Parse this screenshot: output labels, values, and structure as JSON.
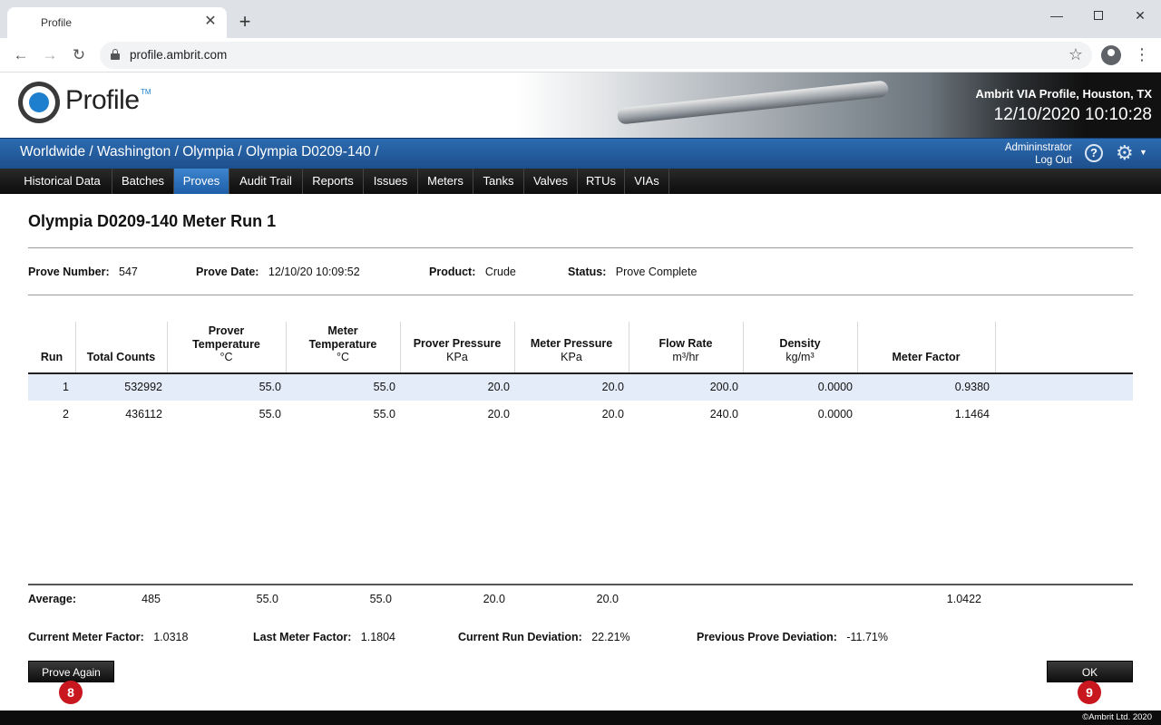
{
  "browser": {
    "tab_title": "Profile",
    "url": "profile.ambrit.com"
  },
  "header": {
    "logo_text": "Profile",
    "logo_tm": "TM",
    "org": "Ambrit VIA Profile, Houston, TX",
    "datetime": "12/10/2020 10:10:28"
  },
  "breadcrumb": "Worldwide / Washington / Olympia / Olympia D0209-140 /",
  "user": {
    "name": "Admininstrator",
    "logout": "Log Out"
  },
  "nav": {
    "items": [
      "Historical Data",
      "Batches",
      "Proves",
      "Audit Trail",
      "Reports",
      "Issues",
      "Meters",
      "Tanks",
      "Valves",
      "RTUs",
      "VIAs"
    ],
    "active": "Proves"
  },
  "page": {
    "title": "Olympia D0209-140 Meter Run 1"
  },
  "prove": {
    "number_label": "Prove Number:",
    "number": "547",
    "date_label": "Prove Date:",
    "date": "12/10/20 10:09:52",
    "product_label": "Product:",
    "product": "Crude",
    "status_label": "Status:",
    "status": "Prove Complete"
  },
  "table": {
    "headers": {
      "run": "Run",
      "total_counts": "Total Counts",
      "prover_temp_1": "Prover",
      "prover_temp_2": "Temperature",
      "prover_temp_unit": "°C",
      "meter_temp_1": "Meter",
      "meter_temp_2": "Temperature",
      "meter_temp_unit": "°C",
      "prover_pressure": "Prover Pressure",
      "prover_pressure_unit": "KPa",
      "meter_pressure": "Meter Pressure",
      "meter_pressure_unit": "KPa",
      "flow_rate": "Flow Rate",
      "flow_rate_unit": "m³/hr",
      "density": "Density",
      "density_unit": "kg/m³",
      "meter_factor": "Meter Factor"
    },
    "rows": [
      {
        "run": "1",
        "total_counts": "532992",
        "prover_temp": "55.0",
        "meter_temp": "55.0",
        "prover_pressure": "20.0",
        "meter_pressure": "20.0",
        "flow_rate": "200.0",
        "density": "0.0000",
        "meter_factor": "0.9380"
      },
      {
        "run": "2",
        "total_counts": "436112",
        "prover_temp": "55.0",
        "meter_temp": "55.0",
        "prover_pressure": "20.0",
        "meter_pressure": "20.0",
        "flow_rate": "240.0",
        "density": "0.0000",
        "meter_factor": "1.1464"
      }
    ],
    "average": {
      "label": "Average:",
      "total_counts": "485",
      "prover_temp": "55.0",
      "meter_temp": "55.0",
      "prover_pressure": "20.0",
      "meter_pressure": "20.0",
      "meter_factor": "1.0422"
    }
  },
  "summary": {
    "current_mf_label": "Current Meter Factor:",
    "current_mf": "1.0318",
    "last_mf_label": "Last Meter Factor:",
    "last_mf": "1.1804",
    "run_dev_label": "Current Run Deviation:",
    "run_dev": "22.21%",
    "prev_dev_label": "Previous Prove Deviation:",
    "prev_dev": "-11.71%"
  },
  "buttons": {
    "prove_again": "Prove Again",
    "ok": "OK"
  },
  "badges": {
    "prove_again": "8",
    "ok": "9"
  },
  "footer": {
    "copyright": "©Ambrit Ltd. 2020"
  },
  "colors": {
    "accent": "#1f5fa8",
    "selected_row": "#e3ecf8",
    "badge": "#c8171e"
  }
}
